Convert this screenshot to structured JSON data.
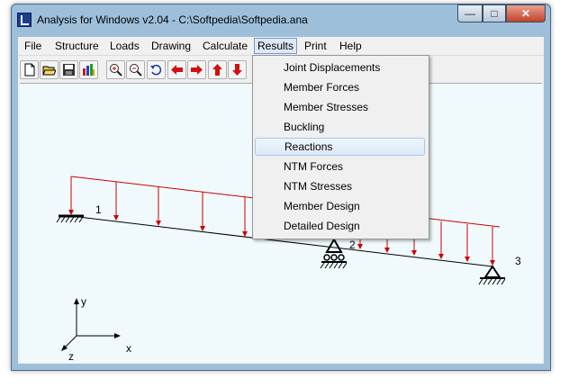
{
  "window": {
    "title": "Analysis for Windows v2.04 - C:\\Softpedia\\Softpedia.ana",
    "controls": {
      "minimize": "—",
      "maximize": "□",
      "close": "✕"
    }
  },
  "menubar": {
    "items": [
      "File",
      "Structure",
      "Loads",
      "Drawing",
      "Calculate",
      "Results",
      "Print",
      "Help"
    ],
    "active": "Results"
  },
  "toolbar": {
    "buttons": [
      "new-icon",
      "open-icon",
      "save-icon",
      "chart-icon",
      "zoom-in-icon",
      "zoom-out-icon",
      "undo-icon",
      "arrow-left-icon",
      "arrow-right-icon",
      "arrow-up-icon",
      "arrow-down-icon"
    ]
  },
  "results_menu": {
    "items": [
      "Joint Displacements",
      "Member Forces",
      "Member Stresses",
      "Buckling",
      "Reactions",
      "NTM Forces",
      "NTM Stresses",
      "Member Design",
      "Detailed Design"
    ],
    "highlighted": "Reactions"
  },
  "structure": {
    "nodes": [
      "1",
      "2",
      "3"
    ],
    "axes": {
      "y": "y",
      "x": "x",
      "z": "z"
    }
  },
  "colors": {
    "load": "#cc0000",
    "member": "#000000",
    "canvas": "#f0fafd",
    "titlebar": "#9ebfda"
  }
}
